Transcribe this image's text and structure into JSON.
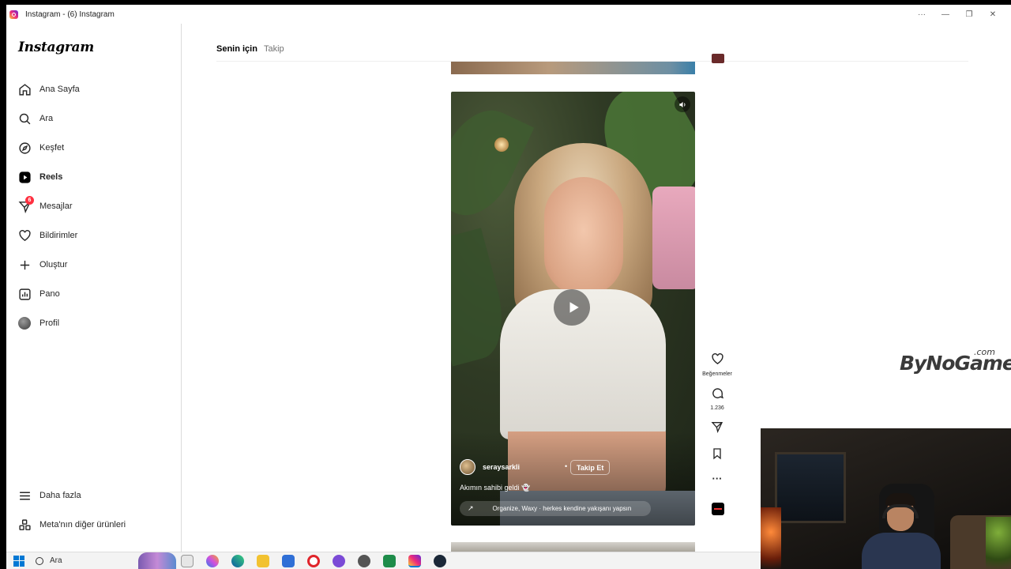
{
  "window": {
    "title": "Instagram - (6) Instagram"
  },
  "sidebar": {
    "logo": "Instagram",
    "items": [
      {
        "label": "Ana Sayfa",
        "icon": "home-icon"
      },
      {
        "label": "Ara",
        "icon": "search-icon"
      },
      {
        "label": "Keşfet",
        "icon": "compass-icon"
      },
      {
        "label": "Reels",
        "icon": "reels-icon",
        "active": true
      },
      {
        "label": "Mesajlar",
        "icon": "messenger-icon",
        "badge": "6"
      },
      {
        "label": "Bildirimler",
        "icon": "heart-icon"
      },
      {
        "label": "Oluştur",
        "icon": "plus-icon"
      },
      {
        "label": "Pano",
        "icon": "dashboard-icon"
      },
      {
        "label": "Profil",
        "icon": "avatar"
      }
    ],
    "more": {
      "label": "Daha fazla",
      "icon": "menu-icon"
    },
    "meta": {
      "label": "Meta'nın diğer ürünleri",
      "icon": "meta-products-icon"
    }
  },
  "feed_tabs": {
    "active": "Senin için",
    "other": "Takip"
  },
  "reel": {
    "username": "seraysarkli",
    "follow_label": "Takip Et",
    "separator": "•",
    "caption": "Akımın sahibi geldi 👻",
    "music": "Organize, Waxy · herkes kendine yakışanı yapsın",
    "mute_icon": "speaker-icon",
    "play_icon": "play-icon"
  },
  "actions": {
    "like_label": "Beğenmeler",
    "comments_count": "1.236"
  },
  "watermark": {
    "brand": "ByNoGame",
    "suffix": ".com"
  },
  "taskbar": {
    "search_placeholder": "Ara"
  },
  "colors": {
    "badge": "#ff3040",
    "accent": "#0095f6",
    "border": "#dbdbdb"
  }
}
